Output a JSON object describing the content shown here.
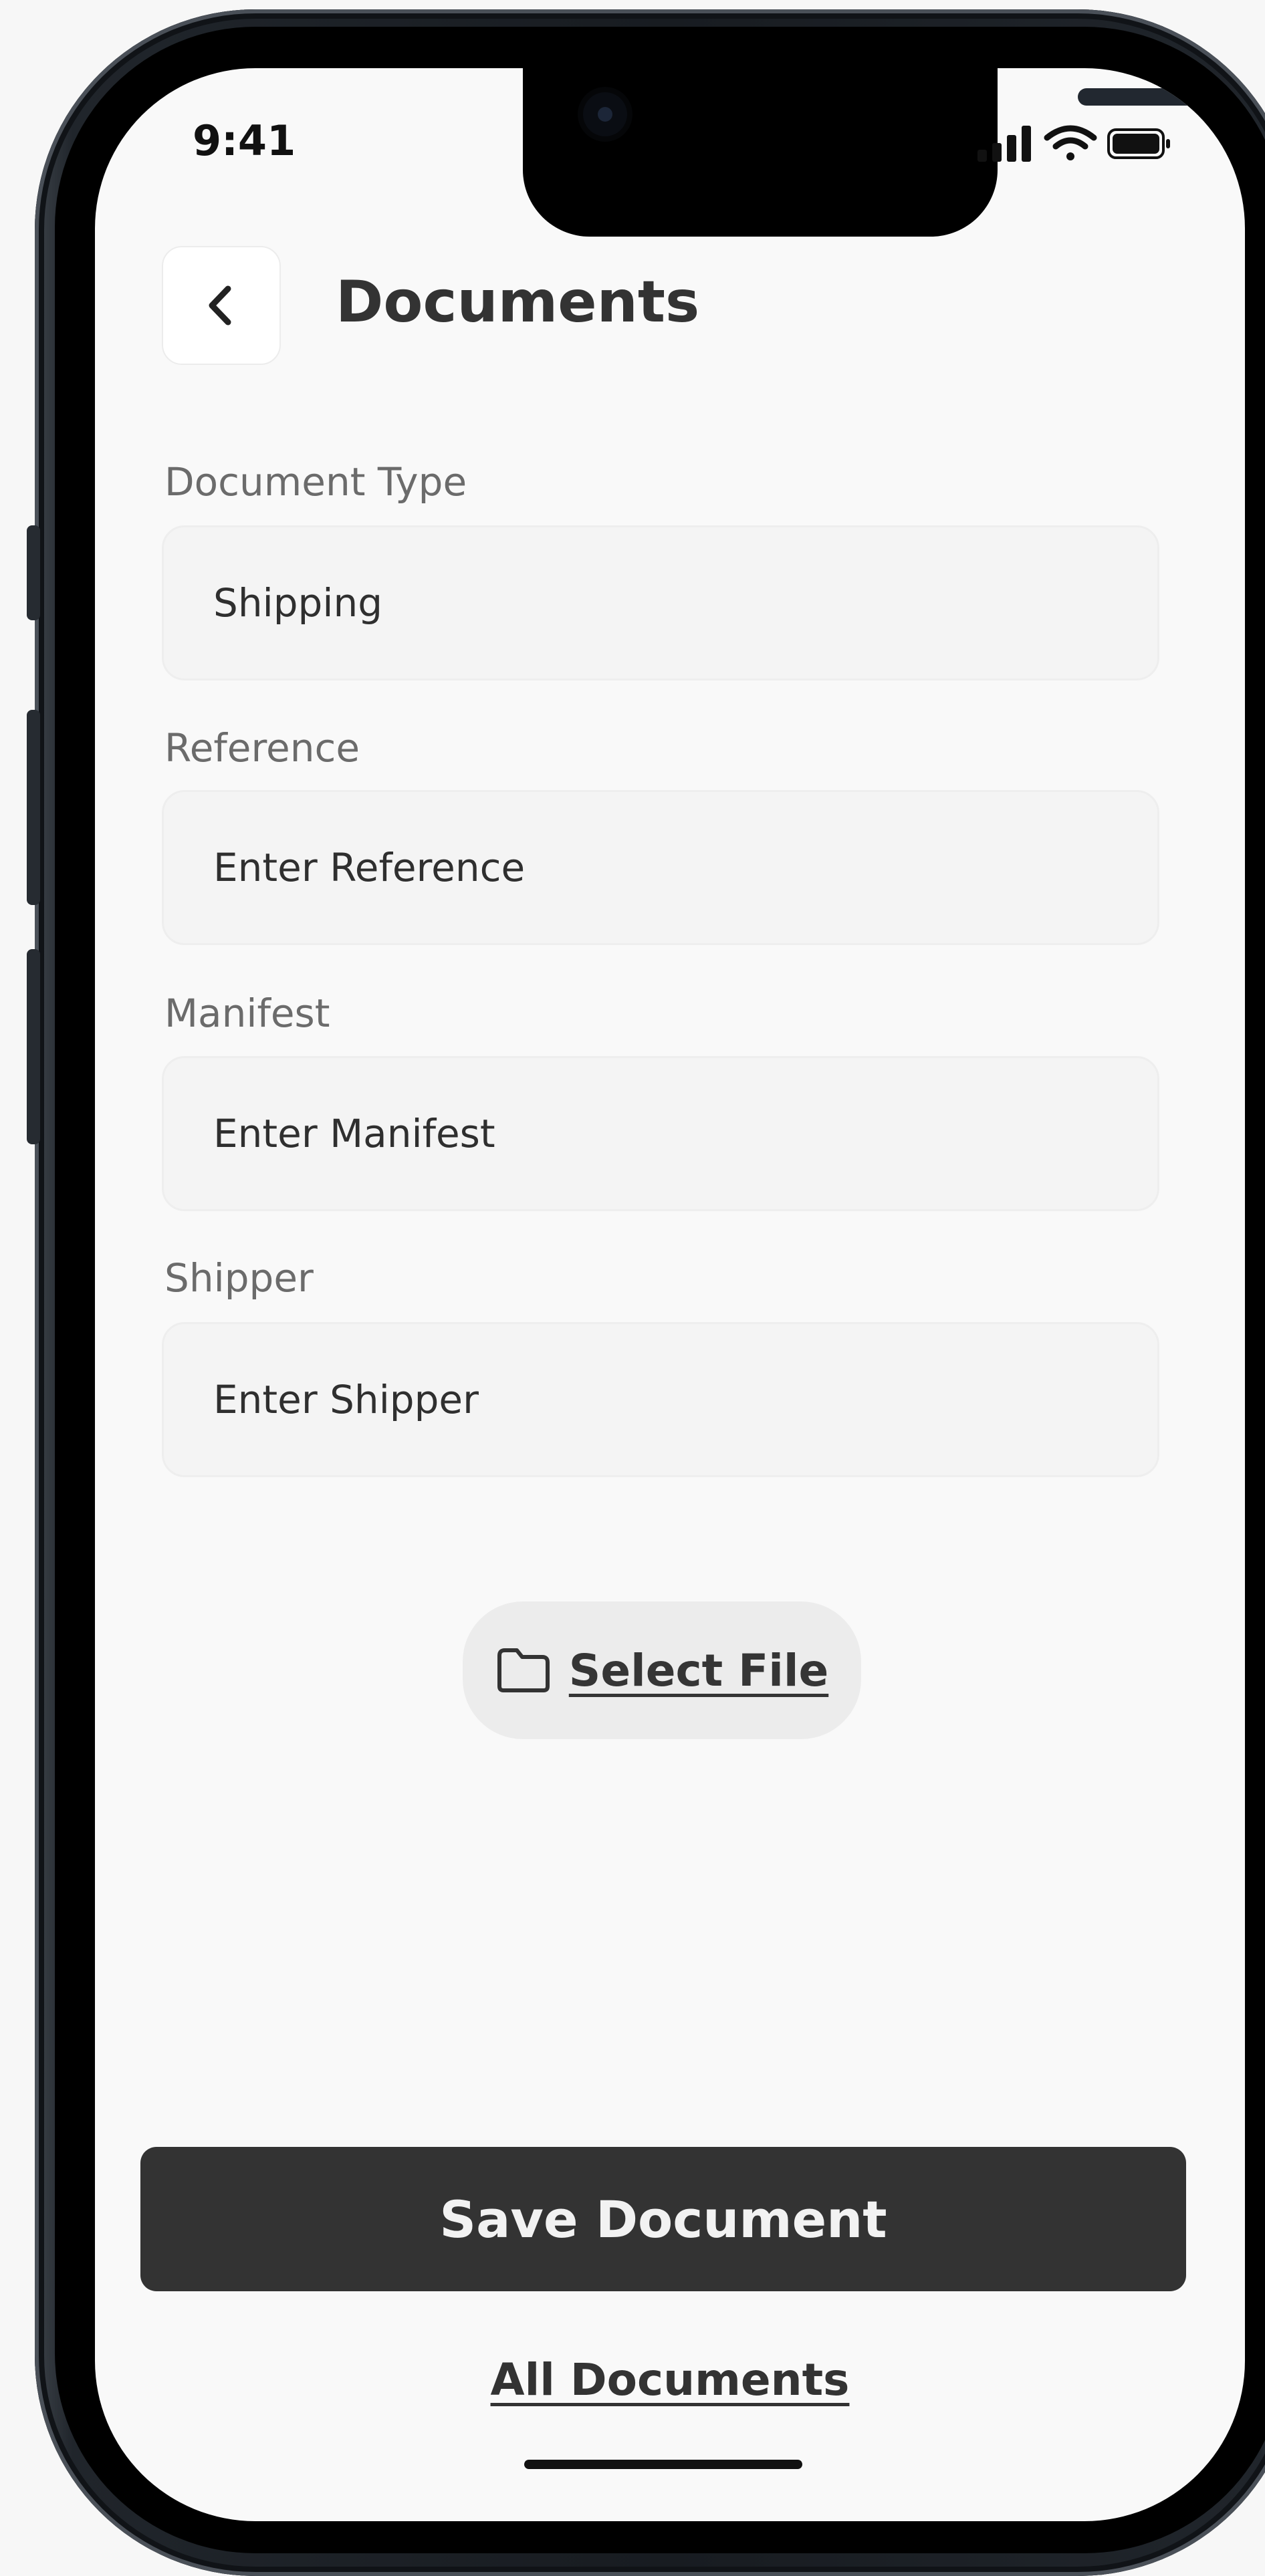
{
  "status_bar": {
    "time": "9:41",
    "icons": [
      "cellular-signal-icon",
      "wifi-icon",
      "battery-icon"
    ]
  },
  "header": {
    "back_icon": "chevron-left-icon",
    "title": "Documents"
  },
  "form": {
    "fields": [
      {
        "label": "Document Type",
        "value": "Shipping",
        "placeholder": ""
      },
      {
        "label": "Reference",
        "value": "",
        "placeholder": "Enter Reference"
      },
      {
        "label": "Manifest",
        "value": "",
        "placeholder": "Enter Manifest"
      },
      {
        "label": "Shipper",
        "value": "",
        "placeholder": "Enter Shipper"
      }
    ]
  },
  "select_file": {
    "icon": "folder-icon",
    "label": "Select File"
  },
  "actions": {
    "save_label": "Save Document",
    "all_documents_label": "All Documents"
  },
  "colors": {
    "primary_button": "#333333",
    "input_background": "#f4f4f4",
    "screen_background": "#f9f9f9"
  }
}
